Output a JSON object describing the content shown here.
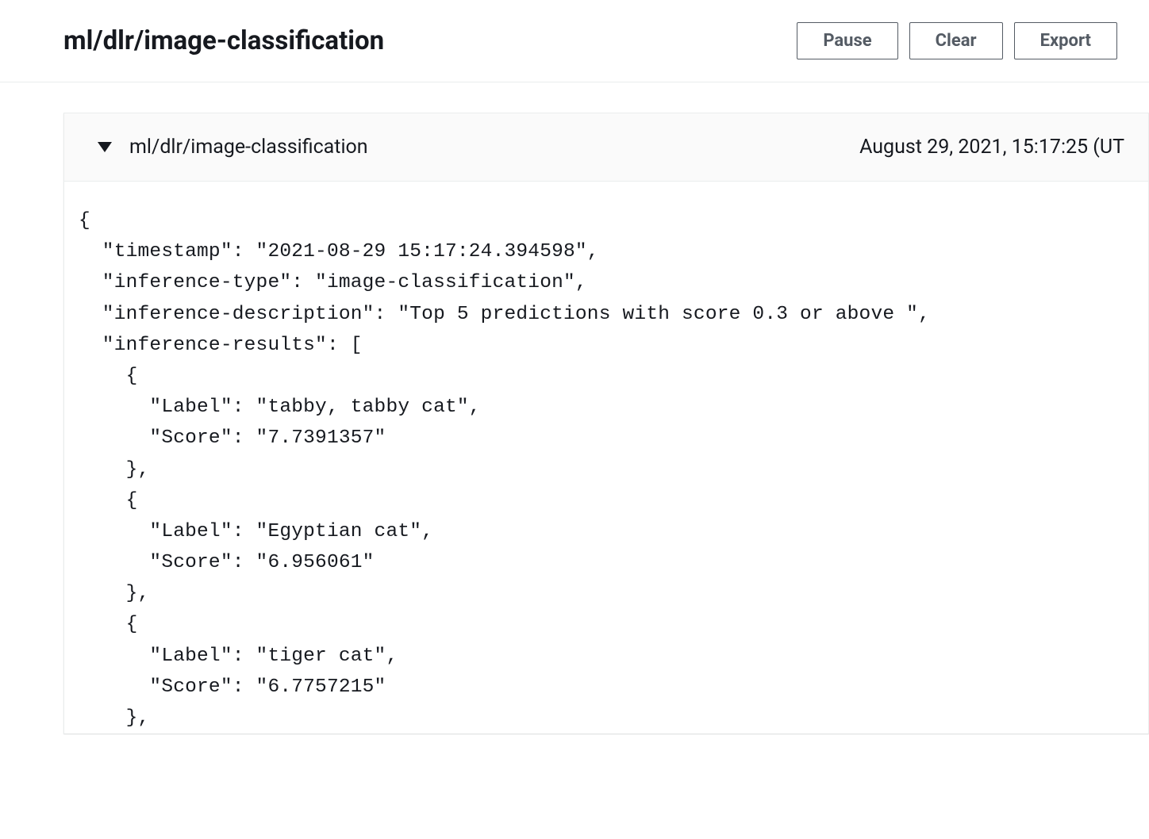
{
  "header": {
    "title": "ml/dlr/image-classification",
    "buttons": {
      "pause": "Pause",
      "clear": "Clear",
      "export": "Export"
    }
  },
  "panel": {
    "title": "ml/dlr/image-classification",
    "timestamp": "August 29, 2021, 15:17:25 (UT"
  },
  "log_entry": {
    "timestamp": "2021-08-29 15:17:24.394598",
    "inference-type": "image-classification",
    "inference-description": "Top 5 predictions with score 0.3 or above ",
    "inference-results": [
      {
        "Label": "tabby, tabby cat",
        "Score": "7.7391357"
      },
      {
        "Label": "Egyptian cat",
        "Score": "6.956061"
      },
      {
        "Label": "tiger cat",
        "Score": "6.7757215"
      }
    ]
  }
}
